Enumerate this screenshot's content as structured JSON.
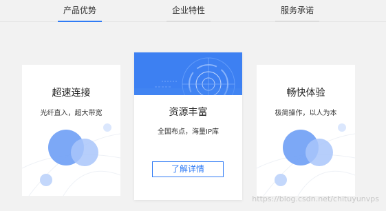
{
  "tabs": [
    {
      "label": "产品优势",
      "active": true
    },
    {
      "label": "企业特性",
      "active": false
    },
    {
      "label": "服务承诺",
      "active": false
    }
  ],
  "cards": {
    "left": {
      "title": "超速连接",
      "subtitle": "光纤直入，超大带宽"
    },
    "center": {
      "title": "资源丰富",
      "subtitle": "全国布点，海量IP库",
      "button_label": "了解详情"
    },
    "right": {
      "title": "畅快体验",
      "subtitle": "极简操作，以人为本"
    }
  },
  "watermark": "https://blog.csdn.net/chituyunvps",
  "colors": {
    "accent": "#2f7bf5",
    "circle_dark": "#6e9ef5",
    "circle_light": "#a9c6fa",
    "circle_pale": "#dbe7fd"
  }
}
